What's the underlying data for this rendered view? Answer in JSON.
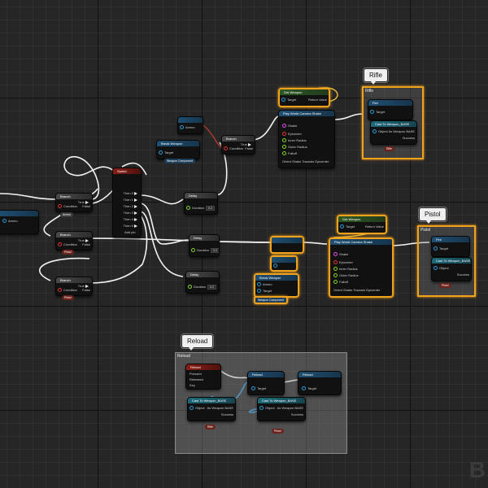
{
  "bubbles": {
    "rifle": "Rifle",
    "pistol": "Pistol",
    "reload": "Reload"
  },
  "comments": {
    "rifle": "Rifle",
    "pistol": "Pistol",
    "reload": "Reload"
  },
  "nodes": {
    "left_input": {
      "label": "Ammo"
    },
    "branch_top": {
      "title": "Branch",
      "true_label": "True",
      "false_label": "False",
      "condition_label": "Condition",
      "pin": "Ammo"
    },
    "branch_mid": {
      "title": "Branch",
      "true_label": "True",
      "false_label": "False",
      "condition_label": "Condition",
      "pin": "Pistol"
    },
    "branch_low": {
      "title": "Branch",
      "true_label": "True",
      "false_label": "False",
      "condition_label": "Condition",
      "pin": "Pistol"
    },
    "switch": {
      "title": "Switch",
      "outs": [
        "Then 0",
        "Then 1",
        "Then 2",
        "Then 3",
        "Then 4",
        "Then 5"
      ],
      "bottom": "Add pin"
    },
    "delay_a": {
      "title": "Delay",
      "pin": "Duration"
    },
    "delay_b": {
      "title": "Delay",
      "pin": "Duration"
    },
    "delay_c": {
      "title": "Delay",
      "pin": "Duration"
    },
    "rifle_branch": {
      "title": "Branch",
      "true_label": "True",
      "false_label": "False",
      "condition_label": "Condition"
    },
    "rifle_getter": {
      "title": "Get Weapon",
      "target": "Target",
      "ret": "Return Value"
    },
    "rifle_shake": {
      "title": "Play World Camera Shake",
      "pins": [
        "Shake",
        "Epicenter",
        "Inner Radius",
        "Outer Radius",
        "Falloff",
        "Orient Shake Towards Epicenter"
      ]
    },
    "rifle_fire": {
      "title": "Fire",
      "target": "Target",
      "sub": "Cast To Weapon_BASE",
      "obj": "Object",
      "as": "As Weapon BASE",
      "success": "Success"
    },
    "rifle_small": {
      "label": "Rifle"
    },
    "pistol_getter": {
      "title": "Get Weapon",
      "target": "Target",
      "ret": "Return Value"
    },
    "pistol_shake": {
      "title": "Play World Camera Shake",
      "pins": [
        "Shake",
        "Epicenter",
        "Inner Radius",
        "Outer Radius",
        "Falloff",
        "Orient Shake Towards Epicenter"
      ]
    },
    "pistol_fire": {
      "title": "Fire",
      "target": "Target",
      "sub": "Cast To Weapon_BASE",
      "obj": "Object",
      "as": "As Weapon BASE",
      "success": "Success"
    },
    "pistol_small": {
      "label": "Pistol"
    },
    "break_node": {
      "title": "Break Weapon",
      "ammo": "Ammo",
      "target": "Target"
    },
    "weapon_component_a": {
      "label": "Weapon Component"
    },
    "weapon_component_b": {
      "label": "Weapon Component"
    },
    "reload_event": {
      "title": "Reload",
      "p1": "Pressed",
      "p2": "Released",
      "p3": "Key"
    },
    "reload_gate": {
      "title": "Reload",
      "target": "Target"
    },
    "reload_reload": {
      "title": "Reload",
      "target": "Target"
    },
    "reload_cast_a": {
      "title": "Cast To Weapon_BASE",
      "obj": "Object",
      "as": "As Weapon BASE",
      "success": "Success",
      "target": "Target"
    },
    "reload_cast_b": {
      "title": "Cast To Weapon_BASE",
      "obj": "Object",
      "as": "As Weapon BASE",
      "success": "Success",
      "target": "Target"
    },
    "reload_var_a": {
      "label": "Rifle"
    },
    "reload_var_b": {
      "label": "Pistol"
    }
  },
  "watermark": "B"
}
